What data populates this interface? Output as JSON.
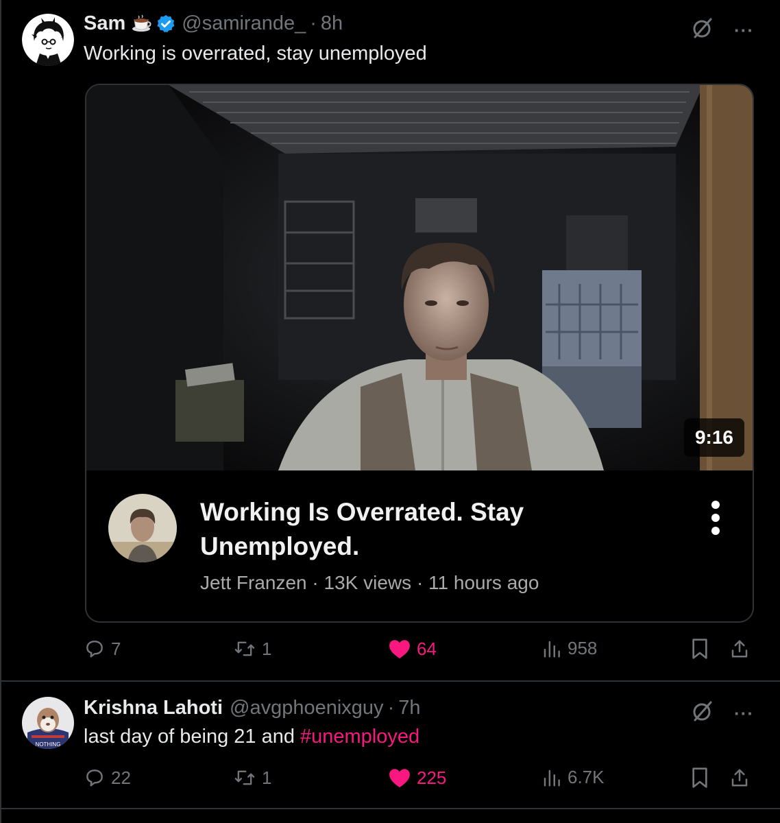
{
  "tweets": [
    {
      "name": "Sam",
      "emoji": "☕",
      "handle": "@samirande_",
      "time": "8h",
      "text": "Working is overrated, stay unemployed",
      "card": {
        "duration": "9:16",
        "title": "Working Is Overrated. Stay Unemployed.",
        "channel": "Jett Franzen",
        "views": "13K views",
        "age": "11 hours ago"
      },
      "actions": {
        "replies": "7",
        "reposts": "1",
        "likes": "64",
        "views": "958"
      }
    },
    {
      "name": "Krishna Lahoti",
      "handle": "@avgphoenixguy",
      "time": "7h",
      "text_prefix": "last day of being 21 and ",
      "hashtag": "#unemployed",
      "avatar_text": "NOTHING",
      "actions": {
        "replies": "22",
        "reposts": "1",
        "likes": "225",
        "views": "6.7K"
      }
    }
  ],
  "separator": "·",
  "colors": {
    "accent_like": "#f91880",
    "verified": "#1d9bf0",
    "muted": "#71767b",
    "border": "#2f3336"
  },
  "icons": [
    "reply-icon",
    "repost-icon",
    "heart-icon",
    "views-icon",
    "bookmark-icon",
    "share-icon",
    "grok-icon",
    "more-icon",
    "verified-icon",
    "coffee-icon"
  ]
}
